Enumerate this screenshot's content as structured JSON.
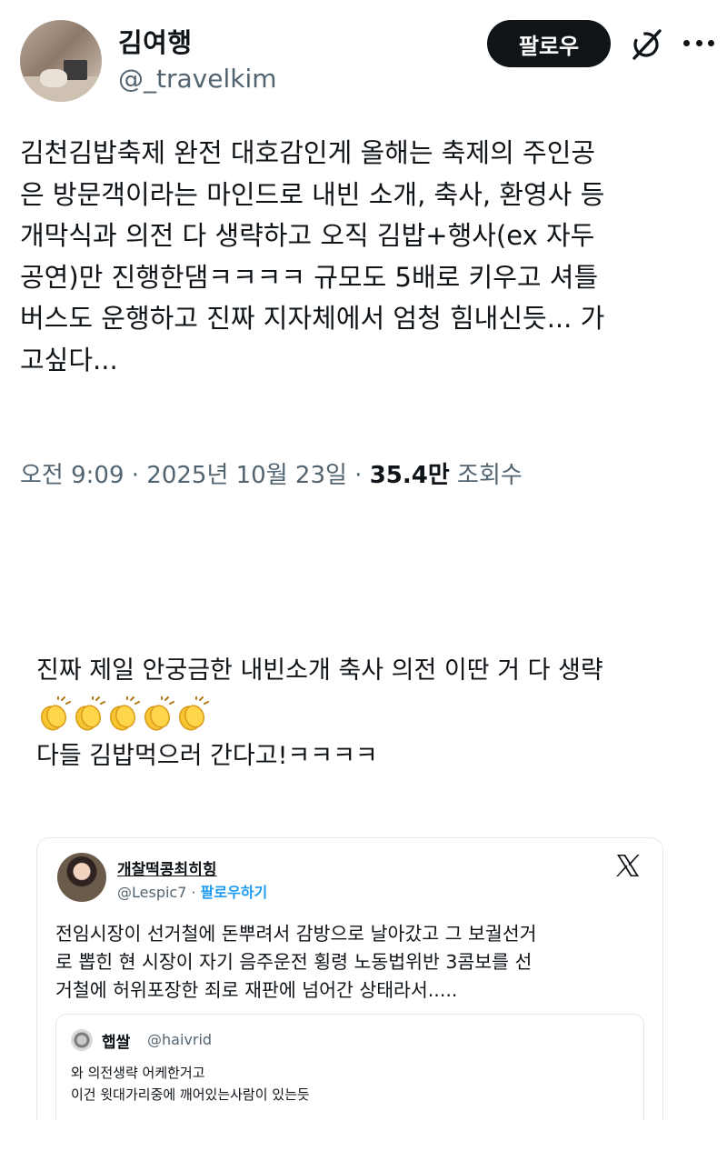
{
  "tweet": {
    "author_name": "김여행",
    "author_handle": "@_travelkim",
    "follow_label": "팔로우",
    "text_lines": [
      "김천김밥축제 완전 대호감인게 올해는 축제의 주인공",
      "은 방문객이라는 마인드로 내빈 소개, 축사, 환영사 등",
      "개막식과 의전 다 생략하고 오직 김밥+행사(ex 자두",
      "공연)만 진행한댐ㅋㅋㅋㅋ 규모도 5배로 키우고 셔틀",
      "버스도 운행하고 진짜 지자체에서 엄청 힘내신듯... 가",
      "고싶다..."
    ],
    "time": "오전 9:09 · 2025년 10월 23일 · ",
    "views_count": "35.4만",
    "views_label": " 조회수"
  },
  "comment": {
    "line1": "진짜 제일 안궁금한 내빈소개 축사 의전 이딴 거 다 생략",
    "clap_icons": [
      "clapping-hands-icon",
      "clapping-hands-icon",
      "clapping-hands-icon",
      "clapping-hands-icon",
      "clapping-hands-icon"
    ],
    "line3": "다들 김밥먹으러 간다고!ㅋㅋㅋㅋ"
  },
  "embed": {
    "author_name": "개찰떡콩최히힝",
    "author_handle": "@Lespic7",
    "separator": " · ",
    "follow_label": "팔로우하기",
    "text_lines": [
      "전임시장이 선거철에 돈뿌려서 감방으로 날아갔고 그 보궐선거",
      "로 뽑힌 현 시장이 자기 음주운전 횡령 노동법위반 3콤보를 선",
      "거철에 허위포장한 죄로 재판에 넘어간 상태라서....."
    ],
    "quote": {
      "author_name": "햅쌀",
      "author_handle": "@haivrid",
      "text_lines": [
        "와 의전생략 어케한거고",
        "이건 윗대가리중에 깨어있는사람이 있는듯"
      ]
    }
  },
  "colors": {
    "text": "#0f1419",
    "secondary": "#536471",
    "link_blue": "#1d9bf0",
    "clap_yellow": "#f7c531",
    "border": "#e6e9ec"
  }
}
